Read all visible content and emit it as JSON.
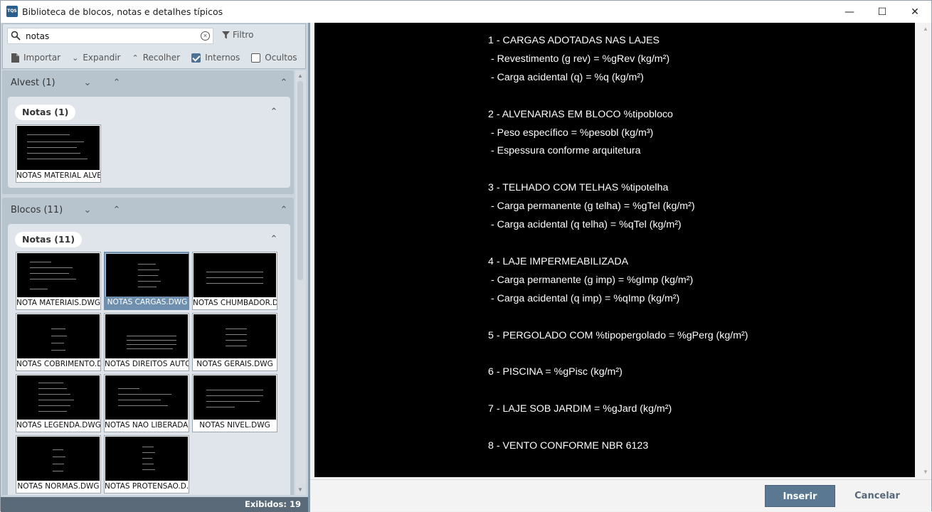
{
  "window": {
    "icon_text": "TQS",
    "title": "Biblioteca de blocos, notas e detalhes típicos",
    "minimize": "—",
    "maximize": "☐",
    "close": "✕"
  },
  "toolbar": {
    "search_value": "notas",
    "filter_label": "Filtro",
    "import_label": "Importar",
    "expand_label": "Expandir",
    "collapse_label": "Recolher",
    "internal_label": "Internos",
    "internal_checked": true,
    "hidden_label": "Ocultos",
    "hidden_checked": false
  },
  "groups": [
    {
      "title": "Alvest (1)",
      "subgroups": [
        {
          "title": "Notas (1)",
          "items": [
            "NOTAS MATERIAL ALVE..."
          ]
        }
      ]
    },
    {
      "title": "Blocos (11)",
      "subgroups": [
        {
          "title": "Notas (11)",
          "items": [
            "NOTA MATERIAIS.DWG",
            "NOTAS CARGAS.DWG",
            "NOTAS CHUMBADOR.D...",
            "NOTAS COBRIMENTO.D...",
            "NOTAS DIREITOS AUTO...",
            "NOTAS GERAIS.DWG",
            "NOTAS LEGENDA.DWG",
            "NOTAS NAO LIBERADA...",
            "NOTAS NIVEL.DWG",
            "NOTAS NORMAS.DWG",
            "NOTAS PROTENSAO.D..."
          ]
        }
      ]
    }
  ],
  "status": "Exibidos: 19",
  "preview_lines": [
    "1 - CARGAS ADOTADAS NAS LAJES",
    " - Revestimento (g rev) = %gRev (kg/m²)",
    " - Carga acidental (q) = %q (kg/m²)",
    "",
    "2 - ALVENARIAS EM BLOCO %tipobloco",
    " - Peso específico = %pesobl (kg/m³)",
    " - Espessura conforme arquitetura",
    "",
    "3 - TELHADO COM TELHAS %tipotelha",
    " - Carga permanente (g telha) = %gTel (kg/m²)",
    " - Carga acidental (q telha) = %qTel (kg/m²)",
    "",
    "4 - LAJE IMPERMEABILIZADA",
    " - Carga permanente (g imp) = %gImp (kg/m²)",
    " - Carga acidental (q imp) = %qImp (kg/m²)",
    "",
    "5 - PERGOLADO COM %tipopergolado = %gPerg (kg/m²)",
    "",
    "6 - PISCINA = %gPisc (kg/m²)",
    "",
    "7 - LAJE SOB JARDIM = %gJard (kg/m²)",
    "",
    "8 - VENTO CONFORME NBR 6123"
  ],
  "buttons": {
    "insert": "Inserir",
    "cancel": "Cancelar"
  }
}
